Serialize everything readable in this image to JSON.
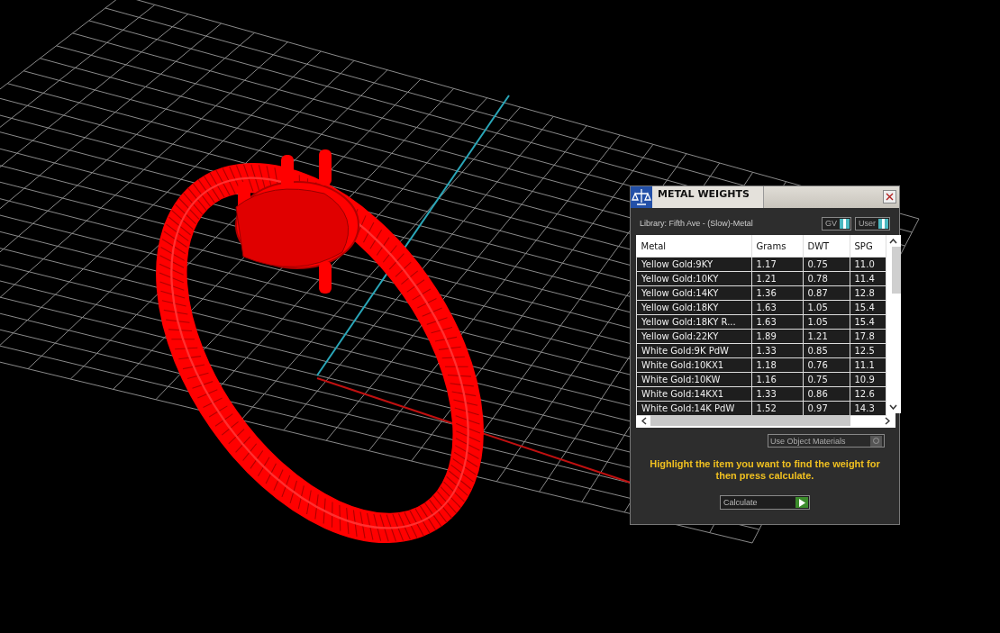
{
  "window": {
    "title": "METAL WEIGHTS"
  },
  "library": "Library: Fifth Ave - (Slow)-Metal",
  "toggles": [
    {
      "label": "GV",
      "on": true
    },
    {
      "label": "User",
      "on": true
    }
  ],
  "table": {
    "columns": [
      "Metal",
      "Grams",
      "DWT",
      "SPG"
    ],
    "rows": [
      [
        "Yellow Gold:9KY",
        "1.17",
        "0.75",
        "11.0"
      ],
      [
        "Yellow Gold:10KY",
        "1.21",
        "0.78",
        "11.4"
      ],
      [
        "Yellow Gold:14KY",
        "1.36",
        "0.87",
        "12.8"
      ],
      [
        "Yellow Gold:18KY",
        "1.63",
        "1.05",
        "15.4"
      ],
      [
        "Yellow Gold:18KY R...",
        "1.63",
        "1.05",
        "15.4"
      ],
      [
        "Yellow Gold:22KY",
        "1.89",
        "1.21",
        "17.8"
      ],
      [
        "White Gold:9K PdW",
        "1.33",
        "0.85",
        "12.5"
      ],
      [
        "White Gold:10KX1",
        "1.18",
        "0.76",
        "11.1"
      ],
      [
        "White Gold:10KW",
        "1.16",
        "0.75",
        "10.9"
      ],
      [
        "White Gold:14KX1",
        "1.33",
        "0.86",
        "12.6"
      ],
      [
        "White Gold:14K PdW",
        "1.52",
        "0.97",
        "14.3"
      ]
    ]
  },
  "use_object_materials": {
    "label": "Use Object Materials",
    "checked": false
  },
  "hint": "Highlight the item you want to find the weight for then press calculate.",
  "calculate_button": "Calculate"
}
